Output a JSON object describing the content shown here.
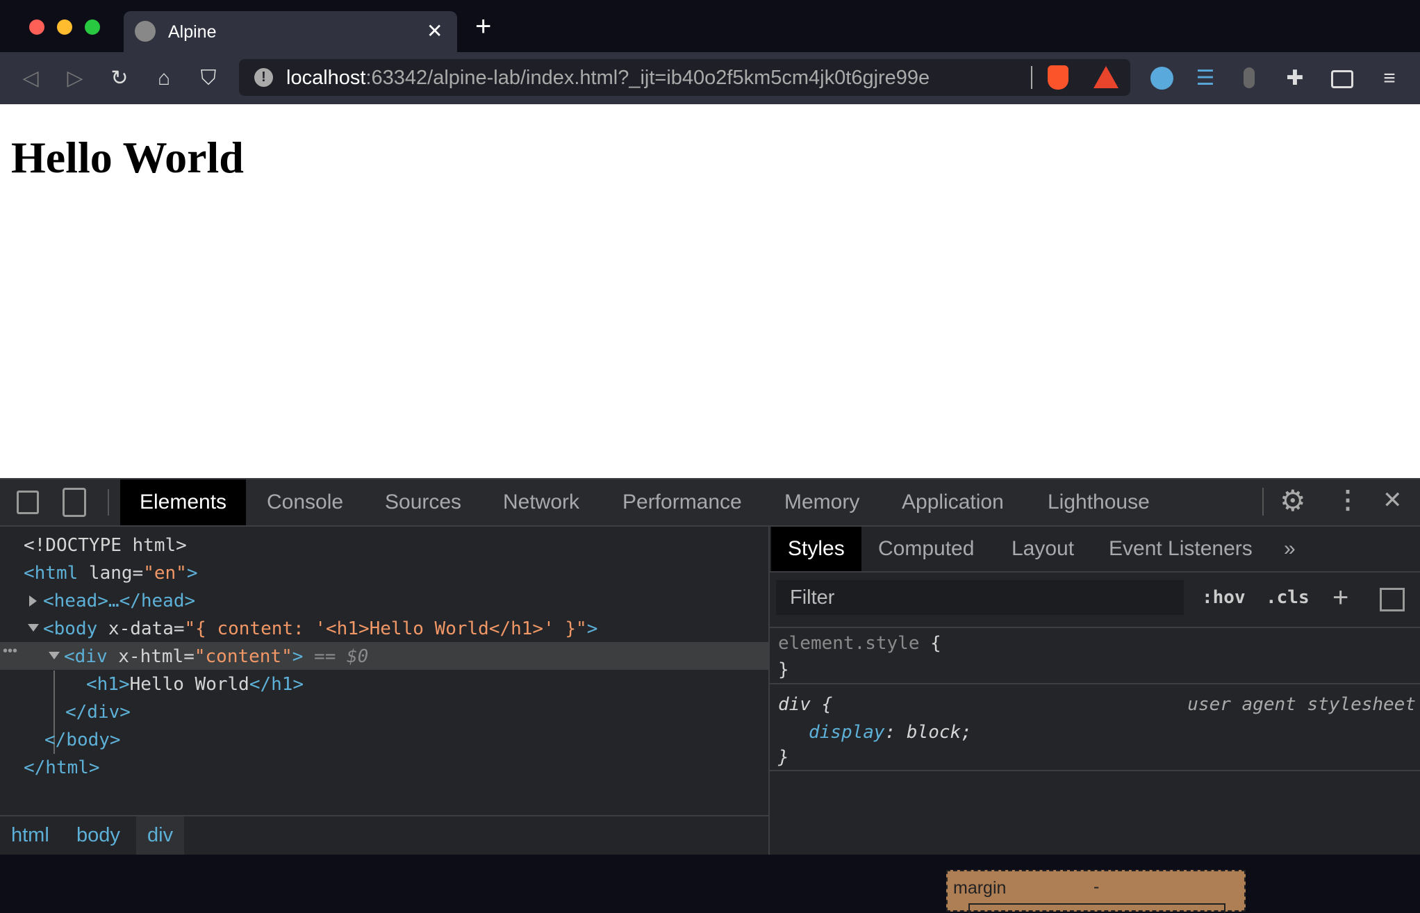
{
  "browser": {
    "tab_title": "Alpine",
    "url_host": "localhost",
    "url_rest": ":63342/alpine-lab/index.html?_ijt=ib40o2f5km5cm4jk0t6gjre99e",
    "colors": {
      "close": "#fe5f57",
      "minimize": "#febc2e",
      "maximize": "#28c840"
    }
  },
  "page": {
    "heading": "Hello World"
  },
  "devtools": {
    "tabs": [
      "Elements",
      "Console",
      "Sources",
      "Network",
      "Performance",
      "Memory",
      "Application",
      "Lighthouse"
    ],
    "dom": {
      "doctype": "<!DOCTYPE html>",
      "html_open": "<html",
      "lang_attr": " lang=",
      "lang_val": "\"en\"",
      "gt": ">",
      "head": "<head>…</head>",
      "body_open": "<body",
      "xdata_attr": " x-data=",
      "xdata_val": "\"{ content: '<h1>Hello World</h1>' }\"",
      "div_open": "<div",
      "xhtml_attr": " x-html=",
      "xhtml_val": "\"content\"",
      "selected_marker": " == $0",
      "h1_open": "<h1>",
      "h1_text": "Hello World",
      "h1_close": "</h1>",
      "div_close": "</div>",
      "body_close": "</body>",
      "html_close": "</html>",
      "dots": "•••"
    },
    "breadcrumbs": [
      "html",
      "body",
      "div"
    ],
    "side_tabs": [
      "Styles",
      "Computed",
      "Layout",
      "Event Listeners"
    ],
    "filter_placeholder": "Filter",
    "hov": ":hov",
    "cls": ".cls",
    "rules": {
      "element_style": "element.style",
      "open": " {",
      "close": "}",
      "div_selector": "div",
      "source": "user agent stylesheet",
      "prop": "display",
      "value": ": block;"
    },
    "box_model": {
      "label": "margin",
      "value": "-"
    }
  }
}
